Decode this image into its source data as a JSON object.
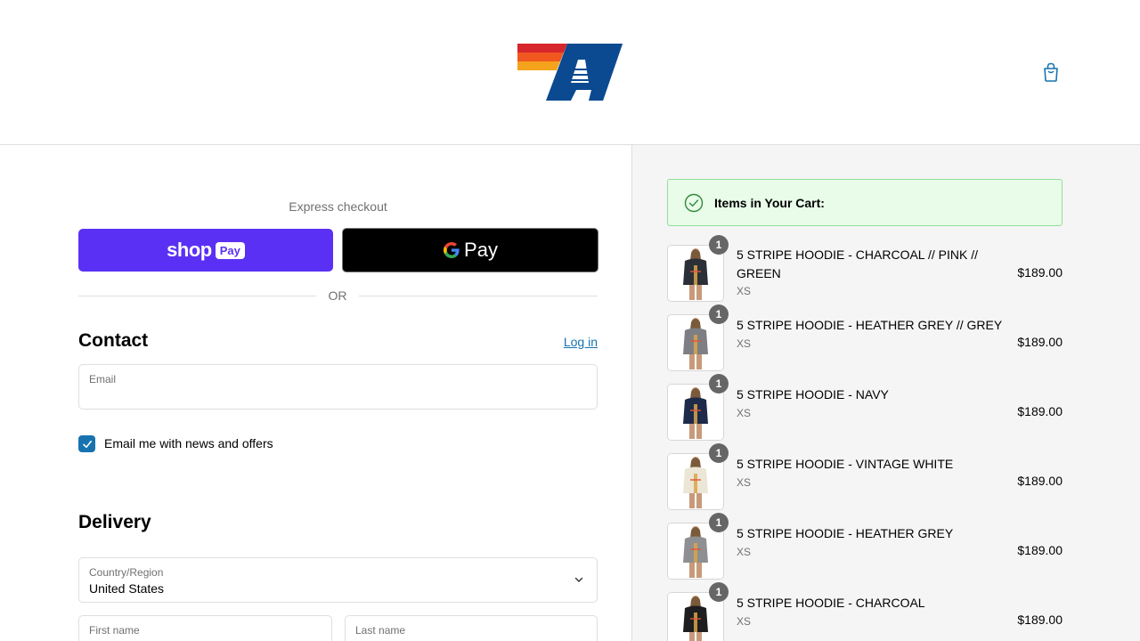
{
  "header": {
    "logo_icon": "av-flag-logo-icon",
    "cart_icon": "shopping-bag-icon",
    "logo_colors": [
      "#d7262b",
      "#f0581f",
      "#f5a21c",
      "#0b4a91"
    ]
  },
  "express": {
    "title": "Express checkout",
    "shop_pay_word": "shop",
    "shop_pay_badge": "Pay",
    "gpay_label": "Pay",
    "or_label": "OR"
  },
  "contact": {
    "heading": "Contact",
    "login_link": "Log in",
    "email_label": "Email",
    "email_value": "",
    "newsletter_checked": true,
    "newsletter_label": "Email me with news and offers"
  },
  "delivery": {
    "heading": "Delivery",
    "country_label": "Country/Region",
    "country_value": "United States",
    "first_name_label": "First name",
    "last_name_label": "Last name"
  },
  "cart": {
    "banner_title": "Items in Your Cart:",
    "accent_green": "#91e099",
    "items": [
      {
        "name": "5 STRIPE HOODIE - CHARCOAL // PINK // GREEN",
        "variant": "XS",
        "price": "$189.00",
        "qty": "1",
        "color": "#2b2f38"
      },
      {
        "name": "5 STRIPE HOODIE - HEATHER GREY // GREY",
        "variant": "XS",
        "price": "$189.00",
        "qty": "1",
        "color": "#7d7f84"
      },
      {
        "name": "5 STRIPE HOODIE - NAVY",
        "variant": "XS",
        "price": "$189.00",
        "qty": "1",
        "color": "#1d2a4a"
      },
      {
        "name": "5 STRIPE HOODIE - VINTAGE WHITE",
        "variant": "XS",
        "price": "$189.00",
        "qty": "1",
        "color": "#ece6d6"
      },
      {
        "name": "5 STRIPE HOODIE - HEATHER GREY",
        "variant": "XS",
        "price": "$189.00",
        "qty": "1",
        "color": "#8d8f92"
      },
      {
        "name": "5 STRIPE HOODIE - CHARCOAL",
        "variant": "XS",
        "price": "$189.00",
        "qty": "1",
        "color": "#1e1e20"
      }
    ]
  }
}
